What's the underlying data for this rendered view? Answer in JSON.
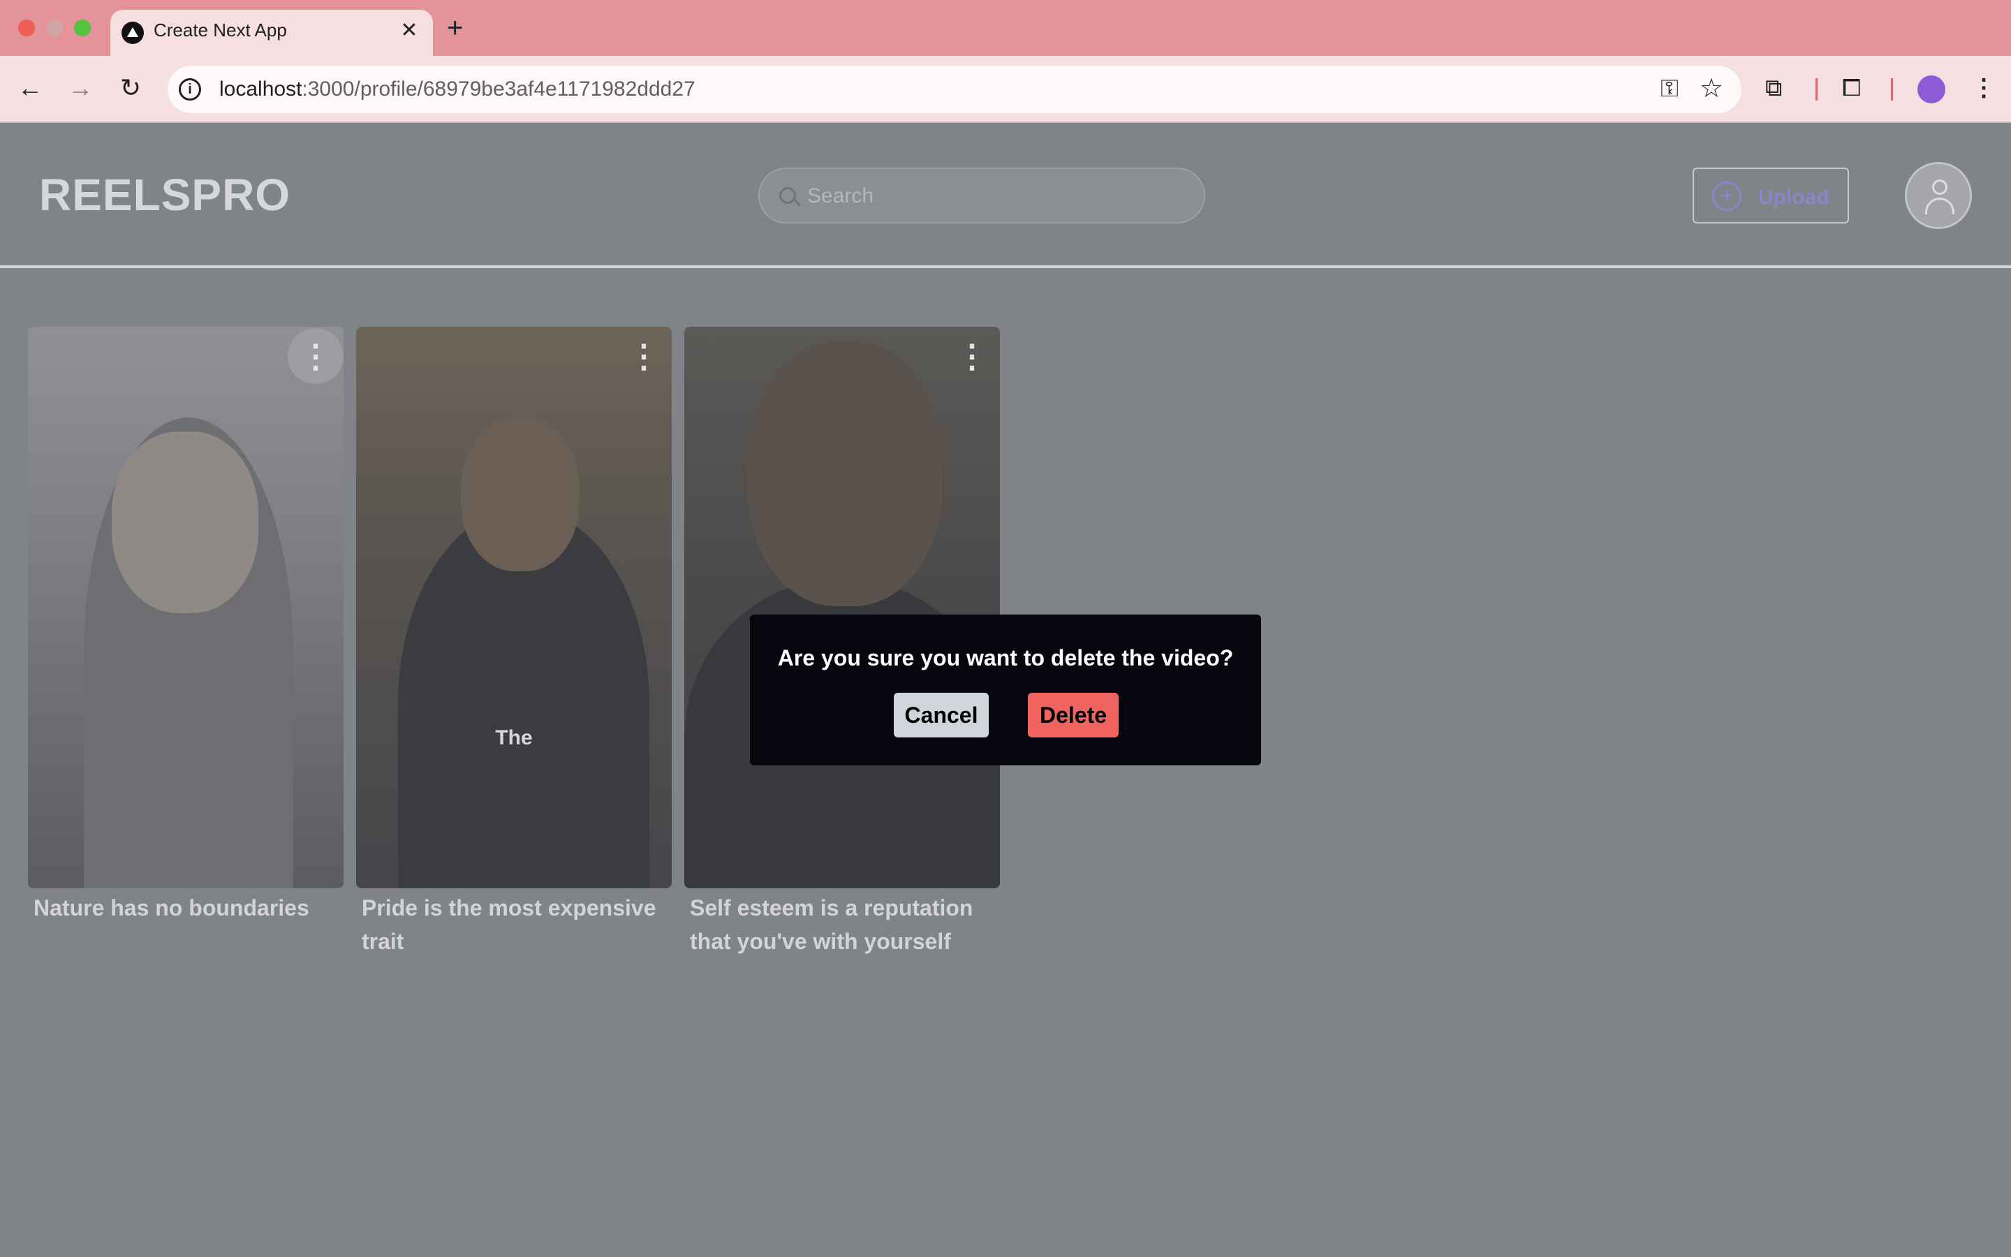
{
  "browser": {
    "tab_title": "Create Next App",
    "tab_close": "✕",
    "new_tab": "+",
    "url_host": "localhost",
    "url_rest": ":3000/profile/68979be3af4e1171982ddd27",
    "nav_back": "←",
    "nav_forward": "→",
    "nav_reload": "↻",
    "menu": "⋮",
    "star": "☆",
    "key": "⚿",
    "extensions": "⧉",
    "cast": "⧠"
  },
  "header": {
    "logo": "REELSPRO",
    "search_placeholder": "Search",
    "upload_label": "Upload",
    "upload_symbol": "+"
  },
  "videos": [
    {
      "title": "Nature has no boundaries",
      "overlay": "",
      "menu": "⋮"
    },
    {
      "title": "Pride is the most expensive trait",
      "overlay": "The",
      "menu": "⋮"
    },
    {
      "title": "Self esteem is a reputation that you've with yourself",
      "overlay": "",
      "menu": "⋮"
    }
  ],
  "modal": {
    "message": "Are you sure you want to delete the video?",
    "cancel_label": "Cancel",
    "delete_label": "Delete"
  },
  "colors": {
    "overlay_bg": "#808388",
    "modal_bg": "#05060e",
    "delete_bg": "#ef6361",
    "cancel_bg": "#d1d5db",
    "tabbar_bg": "#e49499"
  }
}
